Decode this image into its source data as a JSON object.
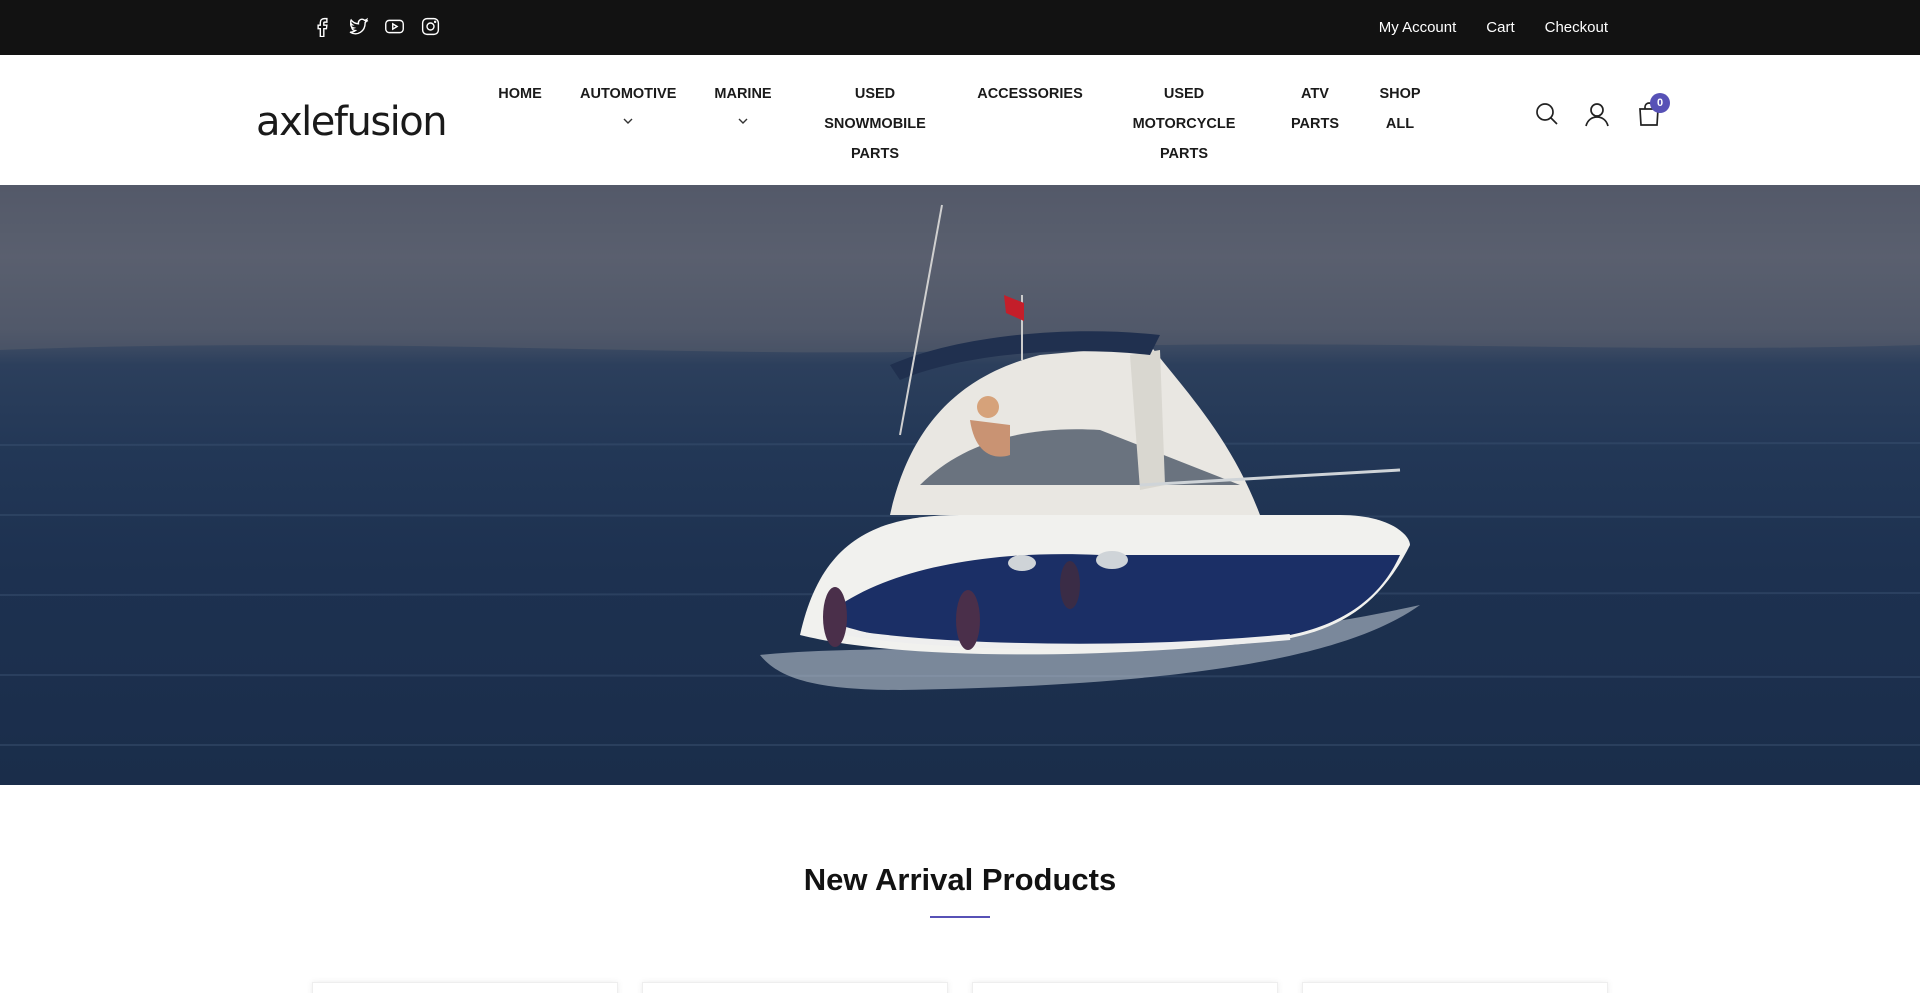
{
  "topbar": {
    "social_icons": [
      "facebook-icon",
      "twitter-icon",
      "youtube-icon",
      "instagram-icon"
    ],
    "links": [
      "My Account",
      "Cart",
      "Checkout"
    ]
  },
  "header": {
    "logo": "axlefusion",
    "nav": [
      {
        "lines": [
          "HOME"
        ],
        "dropdown": false
      },
      {
        "lines": [
          "AUTOMOTIVE"
        ],
        "dropdown": true
      },
      {
        "lines": [
          "MARINE"
        ],
        "dropdown": true
      },
      {
        "lines": [
          "USED",
          "SNOWMOBILE",
          "PARTS"
        ],
        "dropdown": false
      },
      {
        "lines": [
          "ACCESSORIES"
        ],
        "dropdown": false
      },
      {
        "lines": [
          "USED",
          "MOTORCYCLE",
          "PARTS"
        ],
        "dropdown": false
      },
      {
        "lines": [
          "ATV",
          "PARTS"
        ],
        "dropdown": false
      },
      {
        "lines": [
          "SHOP",
          "ALL"
        ],
        "dropdown": false
      }
    ],
    "icons": [
      "search-icon",
      "account-icon",
      "cart-icon"
    ],
    "cart_count": "0"
  },
  "section": {
    "title": "New Arrival Products"
  },
  "colors": {
    "topbar_bg": "#121212",
    "accent": "#5751b6",
    "text": "#121212"
  }
}
